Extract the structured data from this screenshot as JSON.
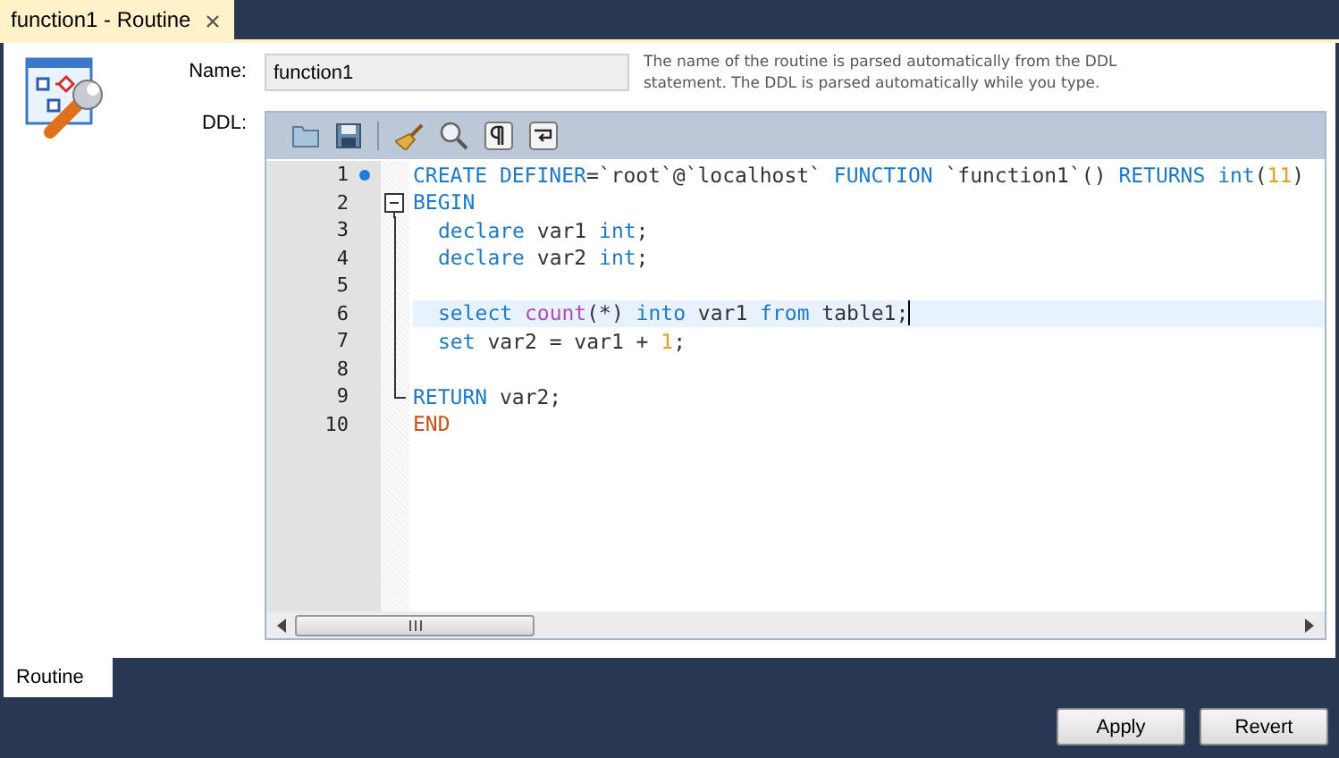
{
  "document_tab": {
    "label": "function1 - Routine",
    "selected": true
  },
  "form": {
    "name_label": "Name:",
    "name_value": "function1",
    "hint": "The name of the routine is parsed automatically from the DDL statement. The DDL is parsed automatically while you type.",
    "ddl_label": "DDL:"
  },
  "editor": {
    "lines": [
      {
        "number": "1",
        "bookmark": true,
        "fold_start": false,
        "in_fold": false,
        "fold_end": false,
        "indented": false,
        "current": false,
        "tokens": [
          {
            "text": "CREATE DEFINER",
            "kind": "keyword"
          },
          {
            "text": "=`root`@`localhost` ",
            "kind": "plain"
          },
          {
            "text": "FUNCTION",
            "kind": "keyword"
          },
          {
            "text": " `function1`",
            "kind": "plain"
          },
          {
            "text": "() ",
            "kind": "plain"
          },
          {
            "text": "RETURNS int",
            "kind": "keyword"
          },
          {
            "text": "(",
            "kind": "plain"
          },
          {
            "text": "11",
            "kind": "number"
          },
          {
            "text": ")",
            "kind": "plain"
          }
        ]
      },
      {
        "number": "2",
        "bookmark": false,
        "fold_start": true,
        "in_fold": false,
        "fold_end": false,
        "indented": false,
        "current": false,
        "tokens": [
          {
            "text": "BEGIN",
            "kind": "keyword"
          }
        ]
      },
      {
        "number": "3",
        "bookmark": false,
        "fold_start": false,
        "in_fold": true,
        "fold_end": false,
        "indented": true,
        "current": false,
        "tokens": [
          {
            "text": "declare",
            "kind": "keyword"
          },
          {
            "text": " var1 ",
            "kind": "plain"
          },
          {
            "text": "int",
            "kind": "keyword"
          },
          {
            "text": ";",
            "kind": "plain"
          }
        ]
      },
      {
        "number": "4",
        "bookmark": false,
        "fold_start": false,
        "in_fold": true,
        "fold_end": false,
        "indented": true,
        "current": false,
        "tokens": [
          {
            "text": "declare",
            "kind": "keyword"
          },
          {
            "text": " var2 ",
            "kind": "plain"
          },
          {
            "text": "int",
            "kind": "keyword"
          },
          {
            "text": ";",
            "kind": "plain"
          }
        ]
      },
      {
        "number": "5",
        "bookmark": false,
        "fold_start": false,
        "in_fold": true,
        "fold_end": false,
        "current": false
      },
      {
        "number": "6",
        "bookmark": false,
        "fold_start": false,
        "in_fold": true,
        "fold_end": false,
        "indented": true,
        "current": true,
        "tokens": [
          {
            "text": "select ",
            "kind": "keyword"
          },
          {
            "text": "count",
            "kind": "function"
          },
          {
            "text": "(*) ",
            "kind": "plain"
          },
          {
            "text": "into",
            "kind": "keyword"
          },
          {
            "text": " var1 ",
            "kind": "plain"
          },
          {
            "text": "from",
            "kind": "keyword"
          },
          {
            "text": " table1;",
            "kind": "plain"
          }
        ]
      },
      {
        "number": "7",
        "bookmark": false,
        "fold_start": false,
        "in_fold": true,
        "fold_end": false,
        "indented": true,
        "current": false,
        "tokens": [
          {
            "text": "set",
            "kind": "keyword"
          },
          {
            "text": " var2 = var1 + ",
            "kind": "plain"
          },
          {
            "text": "1",
            "kind": "number"
          },
          {
            "text": ";",
            "kind": "plain"
          }
        ]
      },
      {
        "number": "8",
        "bookmark": false,
        "fold_start": false,
        "in_fold": true,
        "fold_end": false,
        "current": false
      },
      {
        "number": "9",
        "bookmark": false,
        "fold_start": false,
        "in_fold": false,
        "fold_end": true,
        "indented": false,
        "current": false,
        "tokens": [
          {
            "text": "RETURN",
            "kind": "keyword"
          },
          {
            "text": " var2;",
            "kind": "plain"
          }
        ]
      },
      {
        "number": "10",
        "bookmark": false,
        "fold_start": false,
        "in_fold": false,
        "fold_end": false,
        "indented": false,
        "current": false,
        "tokens": [
          {
            "text": "END",
            "kind": "block_end"
          }
        ]
      }
    ]
  },
  "bottom_tab": {
    "label": "Routine",
    "selected": true
  },
  "buttons": [
    "Apply",
    "Revert"
  ]
}
